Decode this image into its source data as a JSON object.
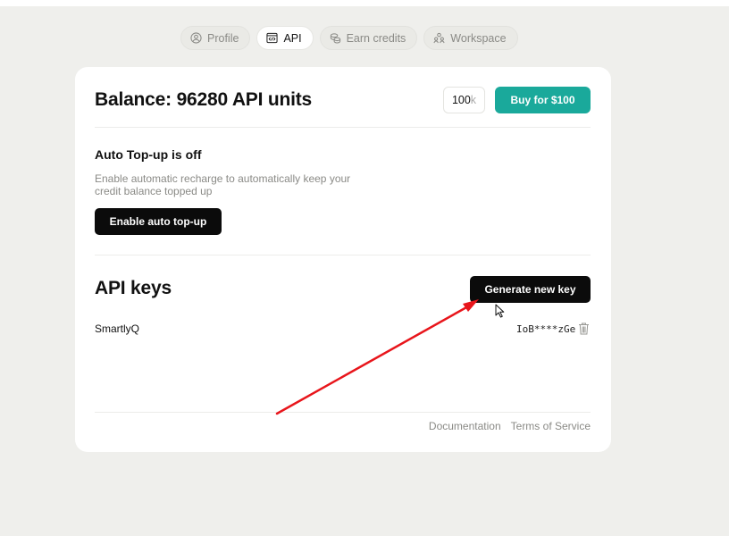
{
  "tabs": [
    {
      "label": "Profile",
      "icon": "user-circle-icon",
      "active": false
    },
    {
      "label": "API",
      "icon": "code-window-icon",
      "active": true
    },
    {
      "label": "Earn credits",
      "icon": "coins-icon",
      "active": false
    },
    {
      "label": "Workspace",
      "icon": "team-icon",
      "active": false
    }
  ],
  "balance": {
    "title": "Balance: 96280 API units",
    "amount_value": "100",
    "amount_unit": "k",
    "buy_label": "Buy for $100"
  },
  "topup": {
    "title": "Auto Top-up is off",
    "description": "Enable automatic recharge to automatically keep your credit balance topped up",
    "button_label": "Enable auto top-up"
  },
  "api_keys": {
    "title": "API keys",
    "generate_label": "Generate new key",
    "keys": [
      {
        "name": "SmartlyQ",
        "masked_value": "IoB****zGe"
      }
    ]
  },
  "footer": {
    "documentation": "Documentation",
    "terms": "Terms of Service"
  },
  "colors": {
    "page_bg": "#efefec",
    "accent": "#1aa99b",
    "annotation_arrow": "#e8151b"
  }
}
